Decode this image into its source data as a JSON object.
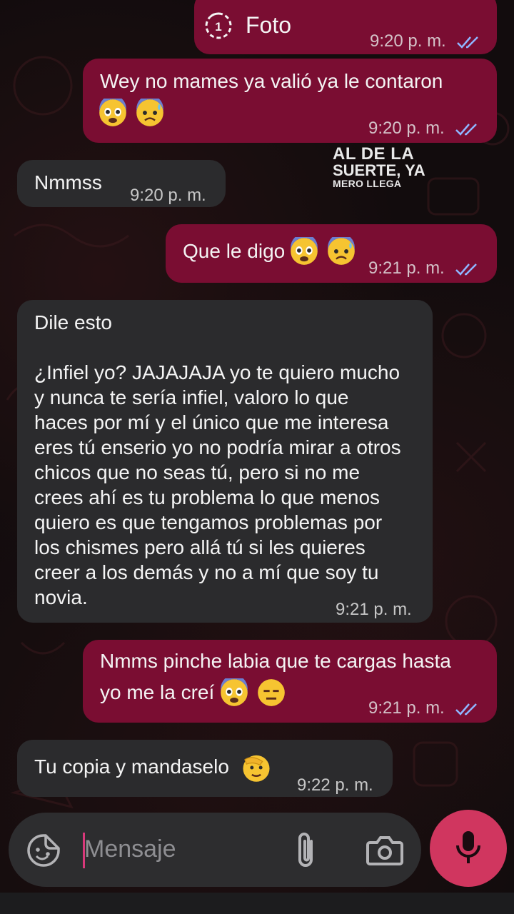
{
  "messages": [
    {
      "type": "sent",
      "kind": "photo",
      "text": "Foto",
      "time": "9:20 p. m.",
      "status": "read"
    },
    {
      "type": "sent",
      "text": "Wey no mames ya valió ya le contaron",
      "emojis": [
        "fearful-face",
        "anxious-face-with-sweat"
      ],
      "time": "9:20 p. m.",
      "status": "read"
    },
    {
      "type": "received",
      "text": "Nmmss",
      "time": "9:20 p. m."
    },
    {
      "type": "sent",
      "text": "Que le digo",
      "emojis": [
        "fearful-face",
        "anxious-face-with-sweat"
      ],
      "time": "9:21 p. m.",
      "status": "read"
    },
    {
      "type": "received",
      "text": "Dile esto\n\n¿Infiel yo? JAJAJAJA yo te quiero mucho y nunca te sería infiel, valoro lo que haces por mí y el único que me interesa eres tú enserio yo no podría mirar a otros chicos que no seas tú, pero si no me crees ahí es tu problema lo que menos quiero es que tengamos problemas por los chismes pero allá tú si les quieres creer a los demás y no a mí que soy tu novia.",
      "lines": [
        "Dile esto",
        "",
        "¿Infiel yo? JAJAJAJA yo te quiero mucho",
        "y nunca te sería infiel, valoro lo que",
        "haces por mí y el único que me interesa",
        "eres tú enserio yo no podría mirar a otros",
        "chicos que no seas tú, pero si no me",
        "crees ahí es tu problema lo que menos",
        "quiero es que tengamos problemas por",
        "los chismes pero allá tú si les quieres",
        "creer a los demás y no a mí que soy tu",
        "novia."
      ],
      "time": "9:21 p. m."
    },
    {
      "type": "sent",
      "text": "Nmms pinche labia que te cargas hasta yo me la creí",
      "lines": [
        "Nmms pinche labia que te cargas hasta",
        "yo me la creí"
      ],
      "emojis": [
        "fearful-face",
        "expressionless-face"
      ],
      "time": "9:21 p. m.",
      "status": "read"
    },
    {
      "type": "received",
      "text": "Tu copia y mandaselo",
      "emojis": [
        "saluting-face"
      ],
      "time": "9:22 p. m."
    }
  ],
  "watermark": {
    "line1": "AL DE LA",
    "line2": "SUERTE, YA",
    "line3": "MERO LLEGA"
  },
  "composer": {
    "placeholder": "Mensaje",
    "icons": [
      "sticker-icon",
      "attach-icon",
      "camera-icon",
      "mic-icon"
    ]
  },
  "colors": {
    "sent_bubble": "#7a0d32",
    "received_bubble": "#2b2b2d",
    "read_ticks": "#8fb6ff",
    "mic_button": "#d0365f"
  }
}
